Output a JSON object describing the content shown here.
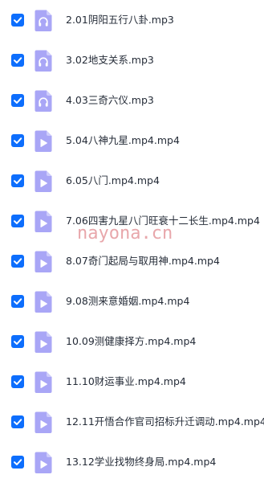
{
  "files": [
    {
      "name": "2.01阴阳五行八卦.mp3",
      "checked": true,
      "type": "audio",
      "icon": "audio-file-icon"
    },
    {
      "name": "3.02地支关系.mp3",
      "checked": true,
      "type": "audio",
      "icon": "audio-file-icon"
    },
    {
      "name": "4.03三奇六仪.mp3",
      "checked": true,
      "type": "audio",
      "icon": "audio-file-icon"
    },
    {
      "name": "5.04八神九星.mp4.mp4",
      "checked": true,
      "type": "video",
      "icon": "video-file-icon"
    },
    {
      "name": "6.05八门.mp4.mp4",
      "checked": true,
      "type": "video",
      "icon": "video-file-icon"
    },
    {
      "name": "7.06四害九星八门旺衰十二长生.mp4.mp4",
      "checked": true,
      "type": "video",
      "icon": "video-file-icon"
    },
    {
      "name": "8.07奇门起局与取用神.mp4.mp4",
      "checked": true,
      "type": "video",
      "icon": "video-file-icon"
    },
    {
      "name": "9.08测来意婚姻.mp4.mp4",
      "checked": true,
      "type": "video",
      "icon": "video-file-icon"
    },
    {
      "name": "10.09测健康择方.mp4.mp4",
      "checked": true,
      "type": "video",
      "icon": "video-file-icon"
    },
    {
      "name": "11.10财运事业.mp4.mp4",
      "checked": true,
      "type": "video",
      "icon": "video-file-icon"
    },
    {
      "name": "12.11开悟合作官司招标升迁调动.mp4.mp4",
      "checked": true,
      "type": "video",
      "icon": "video-file-icon"
    },
    {
      "name": "13.12学业找物终身局.mp4.mp4",
      "checked": true,
      "type": "video",
      "icon": "video-file-icon"
    }
  ],
  "watermark": "nayona.cn",
  "colors": {
    "checkbox": "#0d6efd",
    "icon_body": "#a9a6f6",
    "icon_fold": "#cfcdfb",
    "text": "#252c38",
    "watermark": "#e8a7ab"
  }
}
